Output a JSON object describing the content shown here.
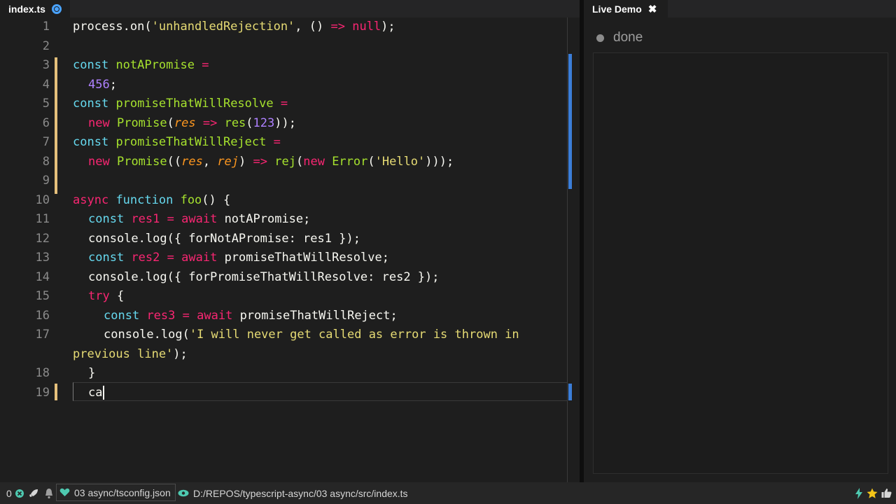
{
  "editor": {
    "tab_label": "index.ts",
    "lines": [
      {
        "n": "1",
        "indent": 0,
        "tokens": [
          [
            "",
            "process.on("
          ],
          [
            "str",
            "'unhandledRejection'"
          ],
          [
            "",
            ", () "
          ],
          [
            "kw2",
            "=>"
          ],
          [
            " ",
            " "
          ],
          [
            "kw2",
            "null"
          ],
          [
            "",
            ");"
          ]
        ]
      },
      {
        "n": "2",
        "indent": 0,
        "tokens": []
      },
      {
        "n": "3",
        "indent": 0,
        "tokens": [
          [
            "kw",
            "const"
          ],
          [
            "",
            " "
          ],
          [
            "fn",
            "notAPromise"
          ],
          [
            "",
            " "
          ],
          [
            "kw2",
            "="
          ]
        ]
      },
      {
        "n": "4",
        "indent": 1,
        "tokens": [
          [
            "num",
            "456"
          ],
          [
            "",
            ";"
          ]
        ]
      },
      {
        "n": "5",
        "indent": 0,
        "tokens": [
          [
            "kw",
            "const"
          ],
          [
            "",
            " "
          ],
          [
            "fn",
            "promiseThatWillResolve"
          ],
          [
            "",
            " "
          ],
          [
            "kw2",
            "="
          ]
        ]
      },
      {
        "n": "6",
        "indent": 1,
        "tokens": [
          [
            "kw2",
            "new"
          ],
          [
            "",
            " "
          ],
          [
            "fn",
            "Promise"
          ],
          [
            "",
            "("
          ],
          [
            "par",
            "res"
          ],
          [
            "",
            " "
          ],
          [
            "kw2",
            "=>"
          ],
          [
            "",
            " "
          ],
          [
            "fn",
            "res"
          ],
          [
            "",
            "("
          ],
          [
            "num",
            "123"
          ],
          [
            "",
            "));"
          ]
        ]
      },
      {
        "n": "7",
        "indent": 0,
        "tokens": [
          [
            "kw",
            "const"
          ],
          [
            "",
            " "
          ],
          [
            "fn",
            "promiseThatWillReject"
          ],
          [
            "",
            " "
          ],
          [
            "kw2",
            "="
          ]
        ]
      },
      {
        "n": "8",
        "indent": 1,
        "tokens": [
          [
            "kw2",
            "new"
          ],
          [
            "",
            " "
          ],
          [
            "fn",
            "Promise"
          ],
          [
            "",
            "(("
          ],
          [
            "par",
            "res"
          ],
          [
            "",
            ", "
          ],
          [
            "par",
            "rej"
          ],
          [
            "",
            ") "
          ],
          [
            "kw2",
            "=>"
          ],
          [
            "",
            " "
          ],
          [
            "fn",
            "rej"
          ],
          [
            "",
            "("
          ],
          [
            "kw2",
            "new"
          ],
          [
            "",
            " "
          ],
          [
            "fn",
            "Error"
          ],
          [
            "",
            "("
          ],
          [
            "str",
            "'Hello'"
          ],
          [
            "",
            ")));"
          ]
        ]
      },
      {
        "n": "9",
        "indent": 0,
        "tokens": []
      },
      {
        "n": "10",
        "indent": 0,
        "tokens": [
          [
            "kw2",
            "async"
          ],
          [
            "",
            " "
          ],
          [
            "kw",
            "function"
          ],
          [
            "",
            " "
          ],
          [
            "fn",
            "foo"
          ],
          [
            "",
            "() {"
          ]
        ]
      },
      {
        "n": "11",
        "indent": 1,
        "tokens": [
          [
            "kw",
            "const"
          ],
          [
            "",
            " "
          ],
          [
            "kw2",
            "res1"
          ],
          [
            "",
            " "
          ],
          [
            "kw2",
            "="
          ],
          [
            "",
            " "
          ],
          [
            "kw2",
            "await"
          ],
          [
            "",
            " notAPromise;"
          ]
        ]
      },
      {
        "n": "12",
        "indent": 1,
        "tokens": [
          [
            "",
            "console.log({ forNotAPromise: res1 });"
          ]
        ]
      },
      {
        "n": "13",
        "indent": 1,
        "tokens": [
          [
            "kw",
            "const"
          ],
          [
            "",
            " "
          ],
          [
            "kw2",
            "res2"
          ],
          [
            "",
            " "
          ],
          [
            "kw2",
            "="
          ],
          [
            "",
            " "
          ],
          [
            "kw2",
            "await"
          ],
          [
            "",
            " promiseThatWillResolve;"
          ]
        ]
      },
      {
        "n": "14",
        "indent": 1,
        "tokens": [
          [
            "",
            "console.log({ forPromiseThatWillResolve: res2 });"
          ]
        ]
      },
      {
        "n": "15",
        "indent": 1,
        "tokens": [
          [
            "kw2",
            "try"
          ],
          [
            "",
            " {"
          ]
        ]
      },
      {
        "n": "16",
        "indent": 2,
        "tokens": [
          [
            "kw",
            "const"
          ],
          [
            "",
            " "
          ],
          [
            "kw2",
            "res3"
          ],
          [
            "",
            " "
          ],
          [
            "kw2",
            "="
          ],
          [
            "",
            " "
          ],
          [
            "kw2",
            "await"
          ],
          [
            "",
            " promiseThatWillReject;"
          ]
        ]
      },
      {
        "n": "17",
        "indent": 2,
        "tokens": [
          [
            "",
            "console.log("
          ],
          [
            "str",
            "'I will never get called as error is thrown in"
          ]
        ]
      },
      {
        "n": "",
        "indent": 0,
        "tokens": [
          [
            "str",
            "previous line'"
          ],
          [
            "",
            ");"
          ]
        ]
      },
      {
        "n": "18",
        "indent": 1,
        "tokens": [
          [
            "",
            "}"
          ]
        ]
      },
      {
        "n": "19",
        "indent": 1,
        "tokens": [
          [
            "",
            "ca"
          ]
        ]
      }
    ]
  },
  "panel": {
    "tab_label": "Live Demo",
    "close_glyph": "✖",
    "console_text": "done"
  },
  "status": {
    "errors": "0",
    "project": "03 async/tsconfig.json",
    "file_path": "D:/REPOS/typescript-async/03 async/src/index.ts"
  }
}
